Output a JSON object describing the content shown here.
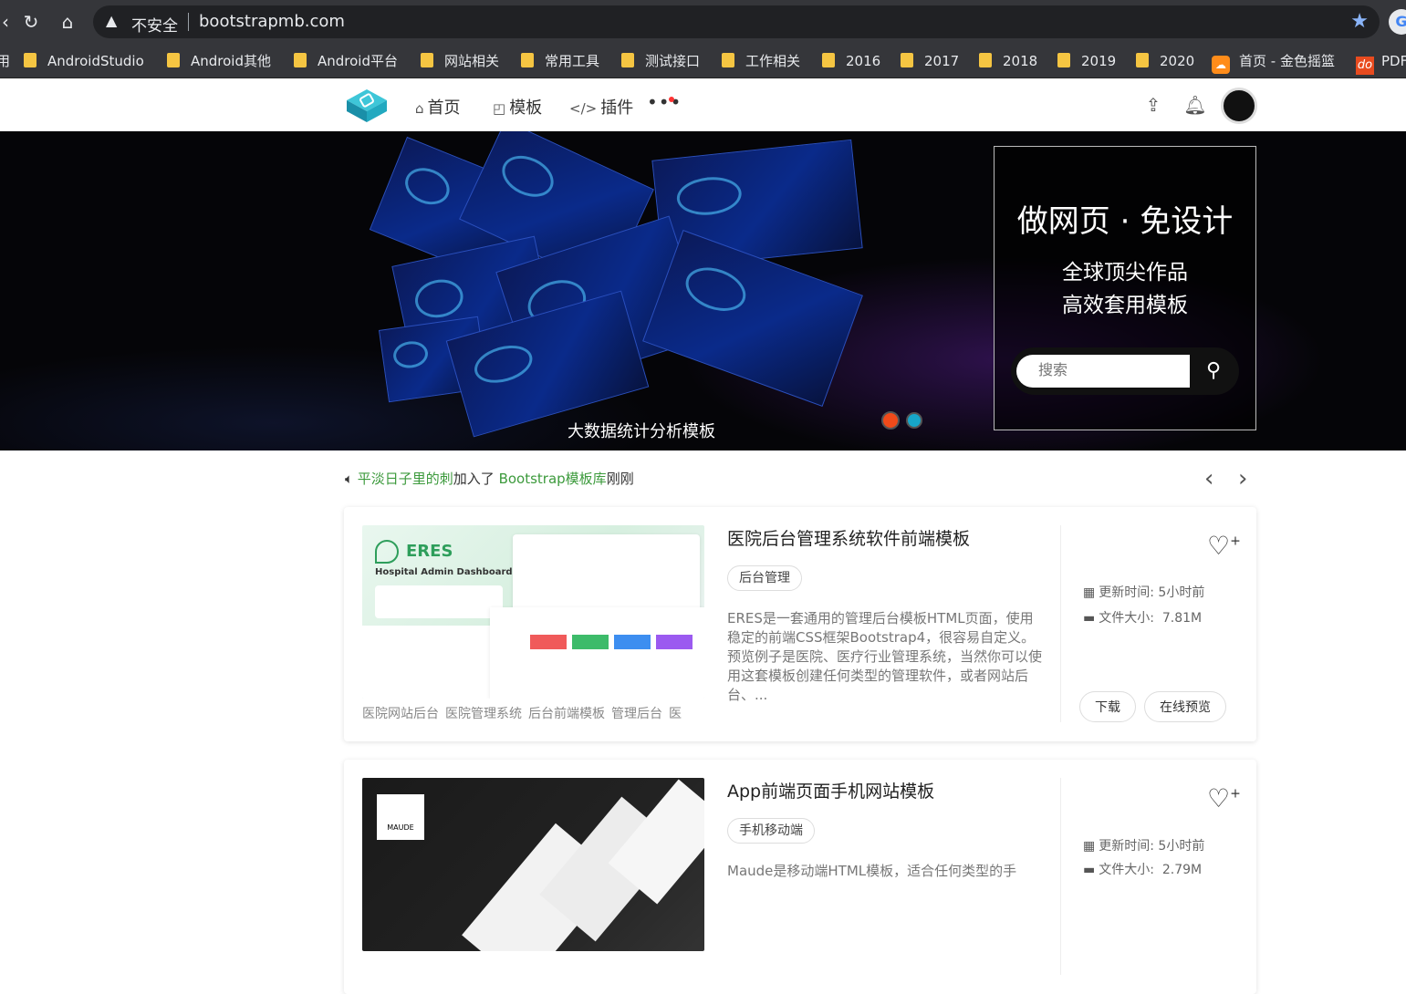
{
  "browser": {
    "insecure_label": "不安全",
    "url": "bootstrapmb.com",
    "profile_initial": "G",
    "bookmarks": [
      "AndroidStudio",
      "Android其他",
      "Android平台",
      "网站相关",
      "常用工具",
      "测试接口",
      "工作相关",
      "2016",
      "2017",
      "2018",
      "2019",
      "2020",
      "首页 - 金色摇篮",
      "PDF"
    ],
    "bookmark_do_icon": "do"
  },
  "site": {
    "nav": [
      {
        "icon": "home-icon",
        "label": "首页"
      },
      {
        "icon": "template-icon",
        "label": "模板"
      },
      {
        "icon": "code-icon",
        "label": "插件"
      }
    ],
    "more_label": "•••"
  },
  "banner": {
    "caption": "大数据统计分析模板",
    "promo_title": "做网页 · 免设计",
    "promo_line1": "全球顶尖作品",
    "promo_line2": "高效套用模板",
    "search_placeholder": "搜索"
  },
  "news": {
    "user": "平淡日子里的刺",
    "action": "加入了 ",
    "target": "Bootstrap模板库",
    "time": "刚刚"
  },
  "cards": [
    {
      "title": "医院后台管理系统软件前端模板",
      "category": "后台管理",
      "description": "ERES是一套通用的管理后台模板HTML页面，使用稳定的前端CSS框架Bootstrap4，很容易自定义。预览例子是医院、医疗行业管理系统，当然你可以使用这套模板创建任何类型的管理软件，或者网站后台、...",
      "tags": [
        "医院网站后台",
        "医院管理系统",
        "后台前端模板",
        "管理后台",
        "医"
      ],
      "updated_label": "更新时间:",
      "updated_value": "5小时前",
      "size_label": "文件大小:",
      "size_value": "7.81M",
      "download_label": "下载",
      "preview_label": "在线预览",
      "thumb_text": "ERES",
      "thumb_sub": "Hospital Admin Dashboard"
    },
    {
      "title": "App前端页面手机网站模板",
      "category": "手机移动端",
      "description": "Maude是移动端HTML模板，适合任何类型的手",
      "updated_label": "更新时间:",
      "updated_value": "5小时前",
      "size_label": "文件大小:",
      "size_value": "2.79M",
      "thumb_text": "MAUDE"
    }
  ]
}
